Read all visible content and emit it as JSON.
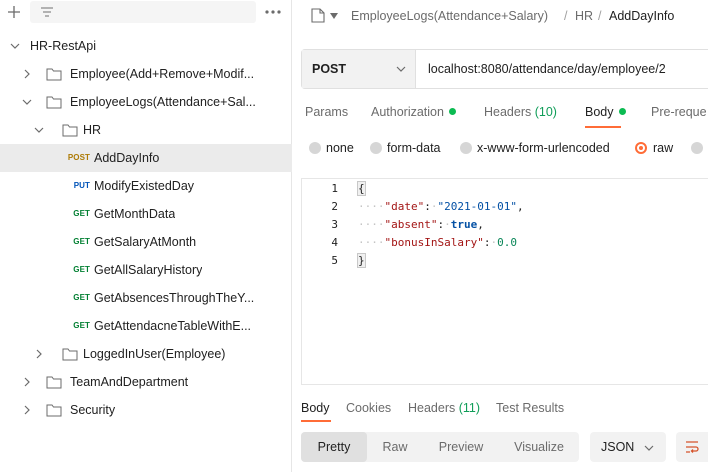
{
  "sidebar": {
    "collection": "HR-RestApi",
    "folders": {
      "employee": "Employee(Add+Remove+Modif...",
      "employee_logs": "EmployeeLogs(Attendance+Sal...",
      "hr": "HR",
      "logged_in": "LoggedInUser(Employee)",
      "team": "TeamAndDepartment",
      "security": "Security"
    },
    "requests": [
      {
        "method": "POST",
        "name": "AddDayInfo"
      },
      {
        "method": "PUT",
        "name": "ModifyExistedDay"
      },
      {
        "method": "GET",
        "name": "GetMonthData"
      },
      {
        "method": "GET",
        "name": "GetSalaryAtMonth"
      },
      {
        "method": "GET",
        "name": "GetAllSalaryHistory"
      },
      {
        "method": "GET",
        "name": "GetAbsencesThroughTheY..."
      },
      {
        "method": "GET",
        "name": "GetAttendacneTableWithE..."
      }
    ]
  },
  "breadcrumb": {
    "collection": "EmployeeLogs(Attendance+Salary)",
    "sep1": "/",
    "folder": "HR",
    "sep2": "/",
    "current": "AddDayInfo"
  },
  "request": {
    "method": "POST",
    "url": "localhost:8080/attendance/day/employee/2"
  },
  "req_tabs": {
    "params": "Params",
    "authorization": "Authorization",
    "headers": "Headers",
    "headers_count": "(10)",
    "body": "Body",
    "prerequest": "Pre-reque"
  },
  "body_types": {
    "none": "none",
    "form_data": "form-data",
    "urlencoded": "x-www-form-urlencoded",
    "raw": "raw"
  },
  "editor": {
    "line_numbers": [
      "1",
      "2",
      "3",
      "4",
      "5"
    ],
    "open_brace": "{",
    "close_brace": "}",
    "indent": "····",
    "key_date": "\"date\"",
    "val_date": "\"2021-01-01\"",
    "key_absent": "\"absent\"",
    "val_absent": "true",
    "key_bonus": "\"bonusInSalary\"",
    "val_bonus": "0.0",
    "colon": ":",
    "comma": ",",
    "space_dot": "·"
  },
  "response_tabs": {
    "body": "Body",
    "cookies": "Cookies",
    "headers": "Headers",
    "headers_count": "(11)",
    "test_results": "Test Results"
  },
  "view": {
    "pretty": "Pretty",
    "raw": "Raw",
    "preview": "Preview",
    "visualize": "Visualize",
    "language": "JSON"
  },
  "colors": {
    "accent": "#ff6c37",
    "status_dot": "#0cbb52",
    "get": "#007f31",
    "post": "#ad7a03",
    "put": "#0053b8"
  }
}
